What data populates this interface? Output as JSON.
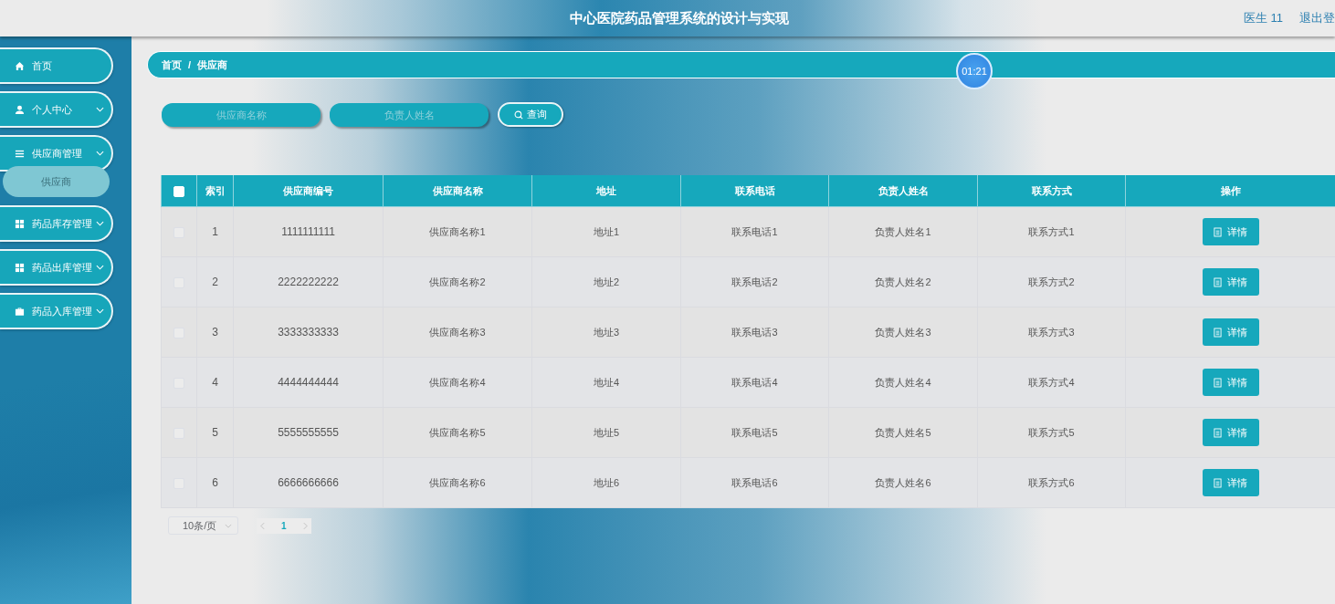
{
  "header": {
    "title": "中心医院药品管理系统的设计与实现",
    "user": "医生 11",
    "logout": "退出登"
  },
  "sidebar": {
    "items": [
      {
        "label": "首页",
        "kind": "home",
        "has_children": false,
        "expanded": false
      },
      {
        "label": "个人中心",
        "kind": "user",
        "has_children": true,
        "expanded": false
      },
      {
        "label": "供应商管理",
        "kind": "list",
        "has_children": true,
        "expanded": true,
        "children": [
          {
            "label": "供应商",
            "selected": true
          }
        ]
      },
      {
        "label": "药品库存管理",
        "kind": "grid",
        "has_children": true,
        "expanded": false
      },
      {
        "label": "药品出库管理",
        "kind": "grid",
        "has_children": true,
        "expanded": false
      },
      {
        "label": "药品入库管理",
        "kind": "case",
        "has_children": true,
        "expanded": false
      }
    ]
  },
  "breadcrumb": {
    "items": [
      "首页",
      "供应商"
    ],
    "separator": "/"
  },
  "timer": "01:21",
  "search": {
    "fields": [
      {
        "placeholder": "供应商名称"
      },
      {
        "placeholder": "负责人姓名"
      }
    ],
    "button": "查询"
  },
  "table": {
    "select_all": {
      "checked": false
    },
    "columns": [
      "索引",
      "供应商编号",
      "供应商名称",
      "地址",
      "联系电话",
      "负责人姓名",
      "联系方式",
      "操作"
    ],
    "rows": [
      {
        "checked": false,
        "cells": [
          "1",
          "1111111111",
          "供应商名称1",
          "地址1",
          "联系电话1",
          "负责人姓名1",
          "联系方式1"
        ],
        "action": "详情"
      },
      {
        "checked": false,
        "cells": [
          "2",
          "2222222222",
          "供应商名称2",
          "地址2",
          "联系电话2",
          "负责人姓名2",
          "联系方式2"
        ],
        "action": "详情"
      },
      {
        "checked": false,
        "cells": [
          "3",
          "3333333333",
          "供应商名称3",
          "地址3",
          "联系电话3",
          "负责人姓名3",
          "联系方式3"
        ],
        "action": "详情"
      },
      {
        "checked": false,
        "cells": [
          "4",
          "4444444444",
          "供应商名称4",
          "地址4",
          "联系电话4",
          "负责人姓名4",
          "联系方式4"
        ],
        "action": "详情"
      },
      {
        "checked": false,
        "cells": [
          "5",
          "5555555555",
          "供应商名称5",
          "地址5",
          "联系电话5",
          "负责人姓名5",
          "联系方式5"
        ],
        "action": "详情"
      },
      {
        "checked": false,
        "cells": [
          "6",
          "6666666666",
          "供应商名称6",
          "地址6",
          "联系电话6",
          "负责人姓名6",
          "联系方式6"
        ],
        "action": "详情"
      }
    ]
  },
  "pagination": {
    "page_size": "10条/页",
    "pages": [
      {
        "label": "1",
        "selected": true
      }
    ]
  }
}
